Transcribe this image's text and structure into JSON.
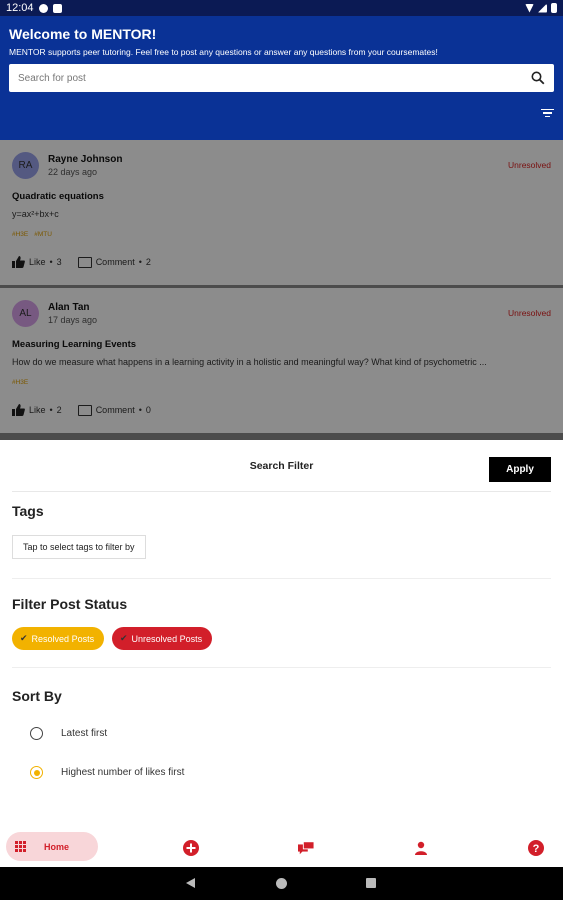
{
  "status_bar": {
    "time": "12:04"
  },
  "header": {
    "title": "Welcome to MENTOR!",
    "subtitle": "MENTOR supports peer tutoring. Feel free to post any questions or answer any questions from your coursemates!",
    "search_placeholder": "Search for post"
  },
  "posts": [
    {
      "initials": "RA",
      "author": "Rayne Johnson",
      "time": "22 days ago",
      "status": "Unresolved",
      "title": "Quadratic equations",
      "body": "y=ax²+bx+c",
      "tags": [
        "#H3E",
        "#MTU"
      ],
      "like_label": "Like",
      "like_count": "3",
      "comment_label": "Comment",
      "comment_count": "2",
      "avatar_color": "#9aa2ec"
    },
    {
      "initials": "AL",
      "author": "Alan Tan",
      "time": "17 days ago",
      "status": "Unresolved",
      "title": "Measuring Learning Events",
      "body": "How do we measure what happens in a learning activity in a holistic and meaningful way? What kind of psychometric ...",
      "tags": [
        "#H3E"
      ],
      "like_label": "Like",
      "like_count": "2",
      "comment_label": "Comment",
      "comment_count": "0",
      "avatar_color": "#d9a3ec"
    }
  ],
  "filter_sheet": {
    "title": "Search Filter",
    "apply_label": "Apply",
    "tags_heading": "Tags",
    "tags_button": "Tap to select tags to filter by",
    "status_heading": "Filter Post Status",
    "chips": [
      {
        "label": "Resolved Posts",
        "color": "#f2b200",
        "selected": true
      },
      {
        "label": "Unresolved Posts",
        "color": "#d21f2a",
        "selected": true
      }
    ],
    "sort_heading": "Sort By",
    "sort_options": [
      {
        "label": "Latest first",
        "selected": false
      },
      {
        "label": "Highest number of likes first",
        "selected": true
      }
    ]
  },
  "bottom_nav": {
    "home_label": "Home",
    "accent_color": "#d21f2a"
  }
}
